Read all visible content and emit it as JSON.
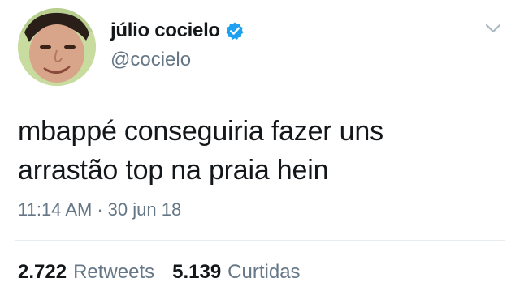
{
  "user": {
    "display_name": "júlio cocielo",
    "handle": "@cocielo",
    "verified": true,
    "avatar_icon": "profile-photo"
  },
  "tweet": {
    "lines": [
      "mbappé conseguiria fazer uns",
      "arrastão top na praia hein"
    ],
    "time": "11:14 AM",
    "separator": "·",
    "date": "30 jun 18"
  },
  "stats": {
    "retweets_count": "2.722",
    "retweets_label": "Retweets",
    "likes_count": "5.139",
    "likes_label": "Curtidas"
  },
  "colors": {
    "text": "#14171a",
    "secondary": "#657786",
    "verified": "#1da1f2",
    "divider": "#e6ecf0"
  },
  "icons": {
    "verified": "verified-badge-icon",
    "menu": "chevron-down-icon"
  }
}
